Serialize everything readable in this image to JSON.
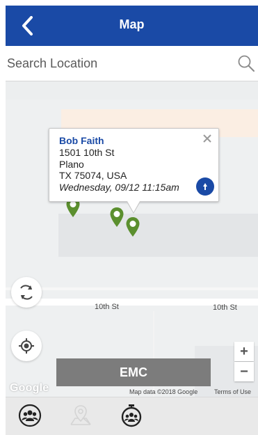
{
  "header": {
    "title": "Map",
    "back_icon": "chevron-left-icon",
    "bg_color": "#1a4aa6"
  },
  "search": {
    "placeholder": "Search Location",
    "value": "",
    "icon": "search-icon"
  },
  "map": {
    "street_labels": [
      "10th St",
      "10th St"
    ],
    "popup": {
      "name": "Bob Faith",
      "address_line1": "1501 10th St",
      "address_line2": "Plano",
      "address_line3": "TX 75074, USA",
      "datetime": "Wednesday, 09/12 11:15am",
      "close_icon": "close-icon",
      "action_icon": "directions-icon"
    },
    "pins": {
      "color": "#5b8f2e",
      "count": 3
    },
    "controls": {
      "refresh_icon": "refresh-icon",
      "locate_icon": "crosshair-icon",
      "zoom_in": "+",
      "zoom_out": "−"
    },
    "emc_button": "EMC",
    "google_logo": "Google",
    "attribution": "Map data ©2018 Google",
    "terms": "Terms of Use"
  },
  "tabbar": {
    "tabs": [
      {
        "icon": "group-icon",
        "active": true
      },
      {
        "icon": "map-location-icon",
        "active": false
      },
      {
        "icon": "stopwatch-group-icon",
        "active": true
      }
    ]
  }
}
